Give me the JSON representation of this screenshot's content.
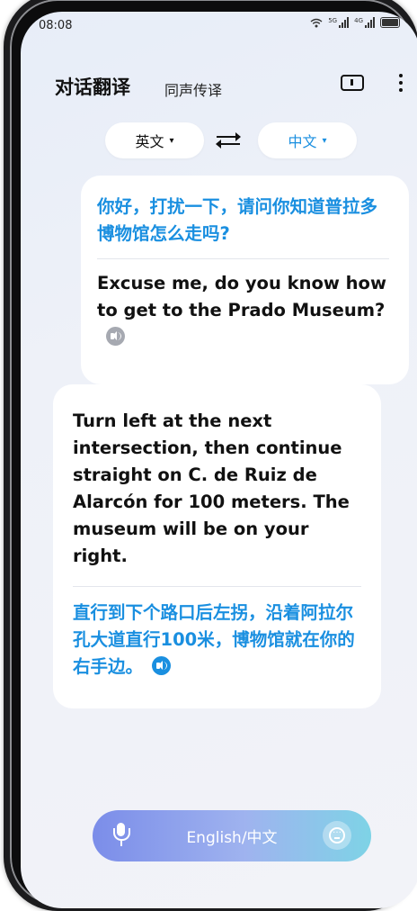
{
  "status_bar": {
    "time": "08:08",
    "signal1_label": "5G",
    "signal2_label": "4G"
  },
  "header": {
    "title": "对话翻译",
    "mode_tab": "同声传译"
  },
  "language": {
    "source": "英文",
    "target": "中文",
    "caret": "▾",
    "target_color": "#1a8fe0"
  },
  "conversation": [
    {
      "side": "right",
      "zh": "你好，打扰一下，请问你知道普拉多博物馆怎么走吗?",
      "en": "Excuse me, do you know how to get to the Prado Museum?",
      "speaker_icon": "speaker-grey-icon"
    },
    {
      "side": "left",
      "en": "Turn left at the next intersection, then continue straight on C. de Ruiz de Alarcón for 100 meters. The museum will be on your right.",
      "zh": "直行到下个路口后左拐，沿着阿拉尔孔大道直行100米，博物馆就在你的右手边。",
      "speaker_icon": "speaker-blue-icon"
    }
  ],
  "input_bar": {
    "label": "English/中文"
  },
  "colors": {
    "accent": "#1a8fe0",
    "card_bg": "#ffffff",
    "muted_icon": "#a6a9b1"
  }
}
